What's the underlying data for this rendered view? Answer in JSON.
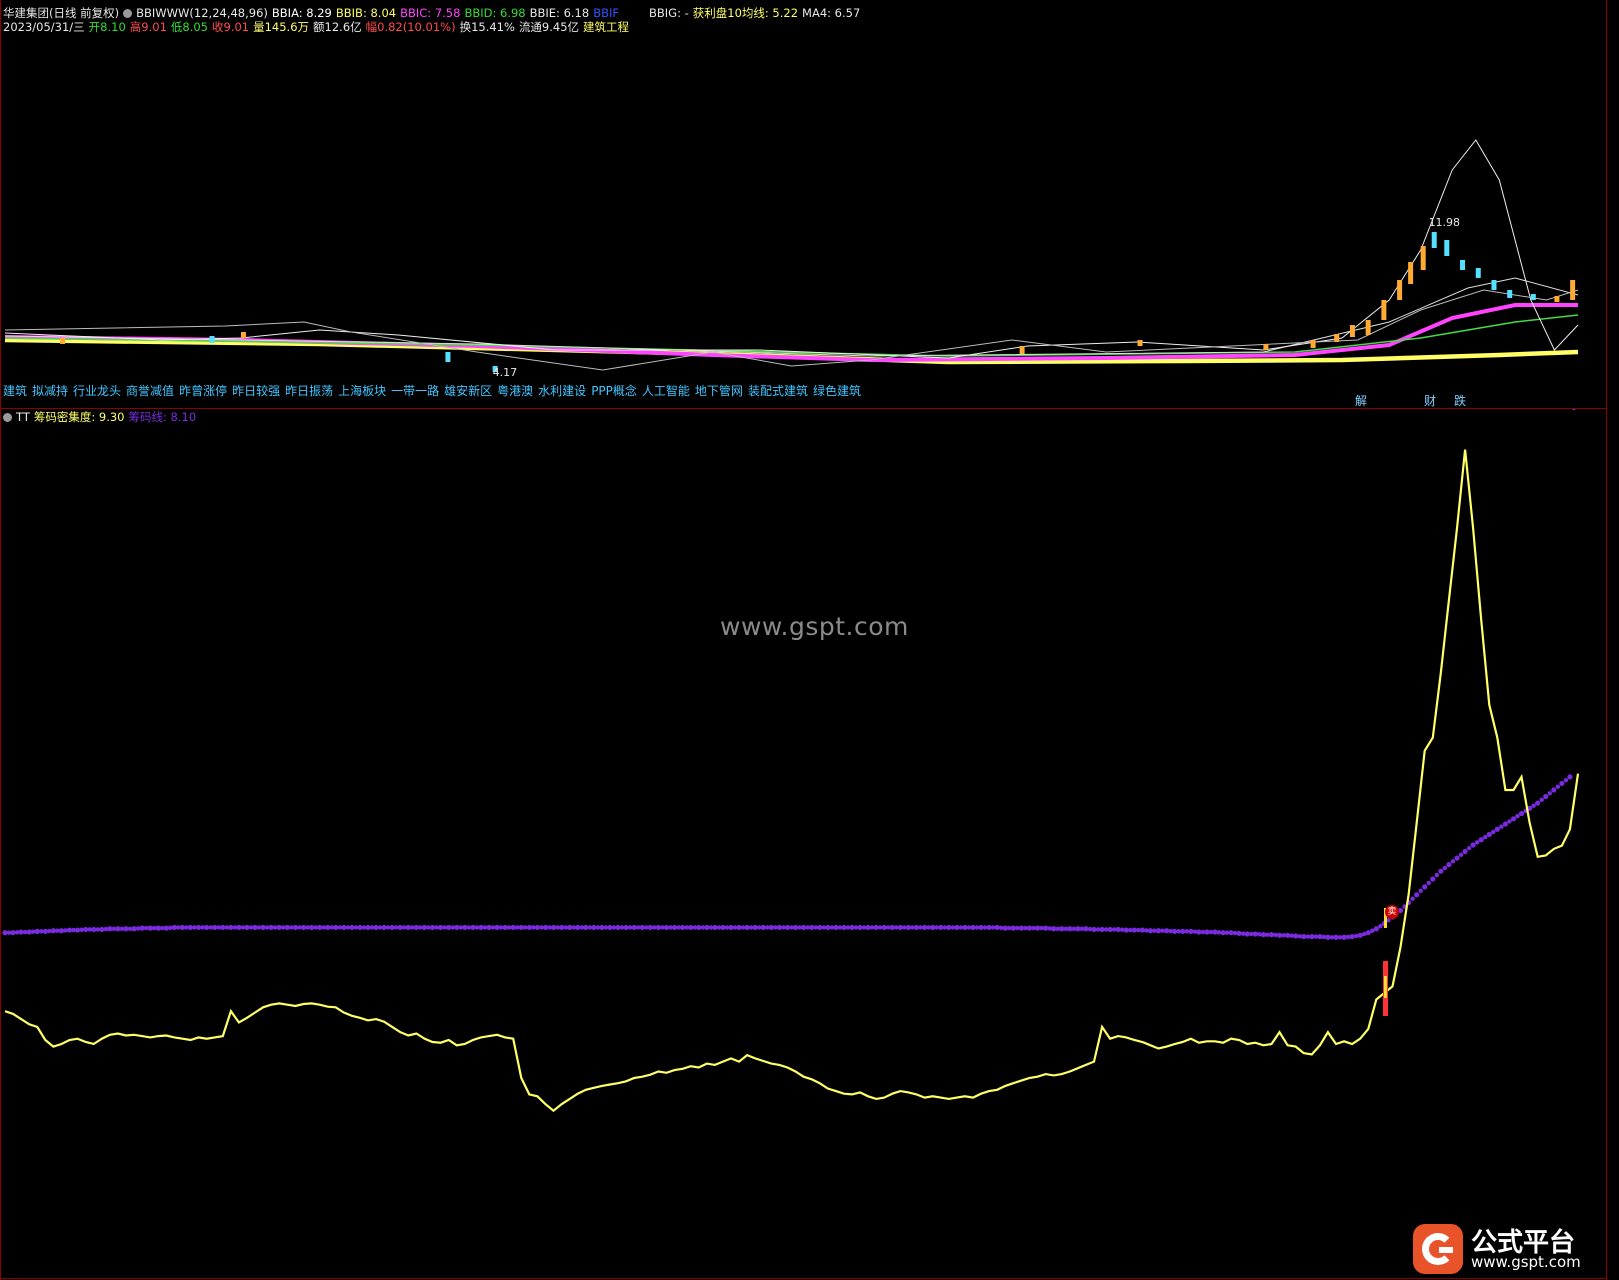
{
  "header": {
    "stock_title": "华建集团(日线 前复权)",
    "indicator_name": "BBIWWW(12,24,48,96)",
    "bbia": "BBIA: 8.29",
    "bbib": "BBIB: 8.04",
    "bbic": "BBIC: 7.58",
    "bbid": "BBID: 6.98",
    "bbie": "BBIE: 6.18",
    "bbif": "BBIF",
    "bbig": "BBIG: -",
    "profit10": "获利盘10均线: 5.22",
    "ma4": "MA4: 6.57"
  },
  "quote": {
    "date": "2023/05/31/三",
    "open": "开8.10",
    "high": "高9.01",
    "low": "低8.05",
    "close": "收9.01",
    "volume": "量145.6万",
    "amount": "额12.6亿",
    "change": "幅0.82(10.01%)",
    "turnover": "换15.41%",
    "float": "流通9.45亿",
    "sector": "建筑工程"
  },
  "tags": [
    "建筑",
    "拟减持",
    "行业龙头",
    "商誉减值",
    "昨曾涨停",
    "昨日较强",
    "昨日振荡",
    "上海板块",
    "一带一路",
    "雄安新区",
    "粤港澳",
    "水利建设",
    "PPP概念",
    "人工智能",
    "地下管网",
    "装配式建筑",
    "绿色建筑"
  ],
  "markers": {
    "m1": "解",
    "m2": "财",
    "m3": "跌"
  },
  "price_labels": {
    "high_label": "11.98",
    "low_label": "4.17"
  },
  "indicator": {
    "name": "TT",
    "line1": "筹码密集度: 9.30",
    "line2": "筹码线: 8.10",
    "signal": "卖"
  },
  "watermark": "www.gspt.com",
  "logo": {
    "title": "公式平台",
    "url": "www.gspt.com"
  },
  "colors": {
    "background": "#000000",
    "yellow_line": "#ffff66",
    "purple_dots": "#7a2be0",
    "magenta": "#ff44ff",
    "white": "#e8e8e8",
    "up": "#ff4d4d",
    "down": "#55e0ff",
    "separator": "#8b0000",
    "orange": "#ffaa33"
  },
  "chart_data": [
    {
      "type": "line",
      "title": "筹码密集度 / 筹码线",
      "series": [
        {
          "name": "筹码密集度",
          "values": [
            3.62,
            3.58,
            3.5,
            3.42,
            3.38,
            3.18,
            3.08,
            3.12,
            3.18,
            3.2,
            3.15,
            3.12,
            3.2,
            3.26,
            3.28,
            3.25,
            3.26,
            3.24,
            3.22,
            3.24,
            3.25,
            3.22,
            3.2,
            3.18,
            3.22,
            3.2,
            3.22,
            3.24,
            3.62,
            3.45,
            3.52,
            3.6,
            3.68,
            3.72,
            3.74,
            3.72,
            3.7,
            3.73,
            3.74,
            3.72,
            3.69,
            3.68,
            3.6,
            3.55,
            3.52,
            3.48,
            3.5,
            3.46,
            3.38,
            3.3,
            3.25,
            3.28,
            3.2,
            3.15,
            3.14,
            3.18,
            3.1,
            3.12,
            3.18,
            3.22,
            3.24,
            3.26,
            3.22,
            3.2,
            2.6,
            2.35,
            2.32,
            2.2,
            2.1,
            2.2,
            2.28,
            2.36,
            2.42,
            2.45,
            2.48,
            2.5,
            2.52,
            2.55,
            2.6,
            2.62,
            2.65,
            2.7,
            2.68,
            2.72,
            2.74,
            2.78,
            2.76,
            2.82,
            2.8,
            2.85,
            2.9,
            2.85,
            2.95,
            2.9,
            2.86,
            2.82,
            2.8,
            2.76,
            2.7,
            2.62,
            2.58,
            2.52,
            2.44,
            2.4,
            2.36,
            2.35,
            2.38,
            2.32,
            2.28,
            2.3,
            2.36,
            2.4,
            2.38,
            2.35,
            2.3,
            2.32,
            2.3,
            2.28,
            2.3,
            2.32,
            2.3,
            2.36,
            2.4,
            2.42,
            2.48,
            2.52,
            2.56,
            2.6,
            2.62,
            2.66,
            2.64,
            2.66,
            2.7,
            2.75,
            2.8,
            2.85,
            3.38,
            3.2,
            3.24,
            3.22,
            3.18,
            3.15,
            3.1,
            3.05,
            3.08,
            3.12,
            3.15,
            3.2,
            3.14,
            3.16,
            3.16,
            3.14,
            3.2,
            3.18,
            3.12,
            3.14,
            3.1,
            3.12,
            3.3,
            3.1,
            3.08,
            2.98,
            2.96,
            3.1,
            3.3,
            3.12,
            3.16,
            3.12,
            3.2,
            3.35,
            3.8,
            3.9,
            4.0,
            4.6,
            5.4,
            6.5,
            7.6,
            7.8,
            8.8,
            9.9,
            11.0,
            12.2,
            11.0,
            9.6,
            8.3,
            7.8,
            7.0,
            7.0,
            7.2,
            6.5,
            5.98,
            6.0,
            6.1,
            6.15,
            6.4,
            7.25
          ]
        },
        {
          "name": "筹码线",
          "values": [
            4.82,
            4.82,
            4.83,
            4.83,
            4.84,
            4.84,
            4.85,
            4.85,
            4.86,
            4.86,
            4.87,
            4.87,
            4.87,
            4.88,
            4.88,
            4.88,
            4.88,
            4.89,
            4.89,
            4.89,
            4.89,
            4.9,
            4.9,
            4.9,
            4.9,
            4.9,
            4.9,
            4.9,
            4.9,
            4.9,
            4.9,
            4.9,
            4.9,
            4.9,
            4.9,
            4.9,
            4.9,
            4.9,
            4.9,
            4.9,
            4.9,
            4.9,
            4.9,
            4.9,
            4.9,
            4.9,
            4.9,
            4.9,
            4.9,
            4.9,
            4.9,
            4.9,
            4.9,
            4.9,
            4.9,
            4.9,
            4.9,
            4.9,
            4.9,
            4.9,
            4.9,
            4.9,
            4.9,
            4.9,
            4.9,
            4.9,
            4.9,
            4.9,
            4.9,
            4.9,
            4.9,
            4.9,
            4.9,
            4.9,
            4.9,
            4.9,
            4.9,
            4.9,
            4.9,
            4.9,
            4.9,
            4.9,
            4.9,
            4.9,
            4.9,
            4.9,
            4.9,
            4.9,
            4.9,
            4.9,
            4.9,
            4.9,
            4.9,
            4.9,
            4.9,
            4.9,
            4.9,
            4.9,
            4.9,
            4.9,
            4.9,
            4.9,
            4.9,
            4.9,
            4.9,
            4.9,
            4.9,
            4.9,
            4.9,
            4.9,
            4.9,
            4.9,
            4.9,
            4.9,
            4.9,
            4.9,
            4.9,
            4.9,
            4.9,
            4.9,
            4.9,
            4.9,
            4.9,
            4.9,
            4.89,
            4.89,
            4.89,
            4.89,
            4.89,
            4.89,
            4.88,
            4.88,
            4.88,
            4.88,
            4.88,
            4.87,
            4.87,
            4.87,
            4.87,
            4.86,
            4.86,
            4.86,
            4.85,
            4.85,
            4.85,
            4.84,
            4.84,
            4.84,
            4.83,
            4.83,
            4.83,
            4.82,
            4.82,
            4.81,
            4.8,
            4.8,
            4.79,
            4.79,
            4.78,
            4.78,
            4.77,
            4.76,
            4.76,
            4.76,
            4.75,
            4.75,
            4.75,
            4.76,
            4.78,
            4.82,
            4.88,
            4.96,
            5.06,
            5.16,
            5.28,
            5.4,
            5.52,
            5.64,
            5.76,
            5.86,
            5.96,
            6.06,
            6.16,
            6.24,
            6.32,
            6.4,
            6.48,
            6.56,
            6.64,
            6.72,
            6.8,
            6.9,
            7.0,
            7.1,
            7.2
          ]
        }
      ]
    }
  ]
}
